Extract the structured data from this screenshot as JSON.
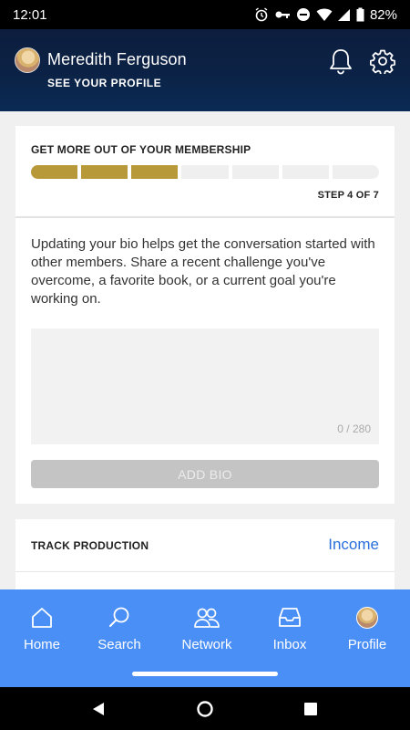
{
  "status_bar": {
    "time": "12:01",
    "battery": "82%"
  },
  "header": {
    "user_name": "Meredith Ferguson",
    "see_profile": "SEE YOUR PROFILE"
  },
  "membership_card": {
    "title": "GET MORE OUT OF YOUR MEMBERSHIP",
    "progress": {
      "completed_steps": 3,
      "total_steps": 7
    },
    "step_text": "STEP 4 OF 7",
    "bio_description": "Updating your bio helps get the conversation started with other members. Share a recent challenge you've overcome, a favorite book, or a current goal you're working on.",
    "bio_input": {
      "value": "",
      "char_count": "0 / 280"
    },
    "add_bio_label": "ADD BIO"
  },
  "track_card": {
    "title": "TRACK PRODUCTION",
    "link_label": "Income"
  },
  "bottom_nav": {
    "items": [
      {
        "label": "Home",
        "icon": "home-icon"
      },
      {
        "label": "Search",
        "icon": "search-icon"
      },
      {
        "label": "Network",
        "icon": "network-icon"
      },
      {
        "label": "Inbox",
        "icon": "inbox-icon"
      },
      {
        "label": "Profile",
        "icon": "avatar"
      }
    ]
  },
  "colors": {
    "header_bg": "#0b2347",
    "progress_done": "#b8993a",
    "nav_bg": "#4a8ff5",
    "link": "#2a6fdc",
    "button_disabled": "#c4c4c4"
  }
}
